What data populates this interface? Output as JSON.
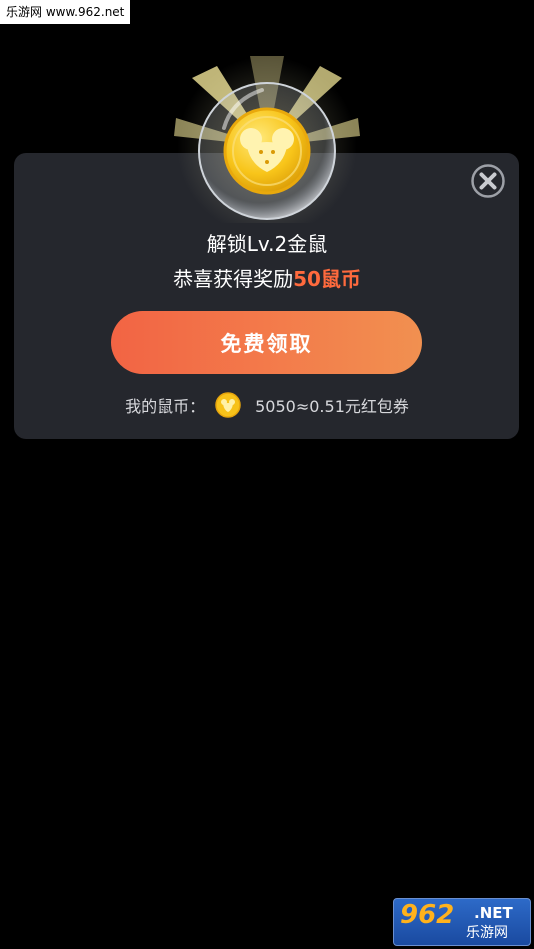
{
  "watermark": {
    "top_text": "乐游网 www.962.net",
    "bottom_logo": "962",
    "bottom_net": ".NET",
    "bottom_cn": "乐游网"
  },
  "dialog": {
    "title": "解锁Lv.2金鼠",
    "subtitle_prefix": "恭喜获得奖励",
    "reward_amount": "50",
    "reward_unit": "鼠币",
    "claim_button": "免费领取",
    "balance_label": "我的鼠币：",
    "balance_value": "5050≈0.51元红包券",
    "close_icon": "close-icon",
    "coin_icon": "mouse-coin-icon"
  },
  "colors": {
    "background": "#000000",
    "dialog_bg": "#25272d",
    "accent": "#ff6a3d",
    "button_start": "#f26444",
    "button_end": "#f19050",
    "coin_gold": "#f7c21a"
  }
}
